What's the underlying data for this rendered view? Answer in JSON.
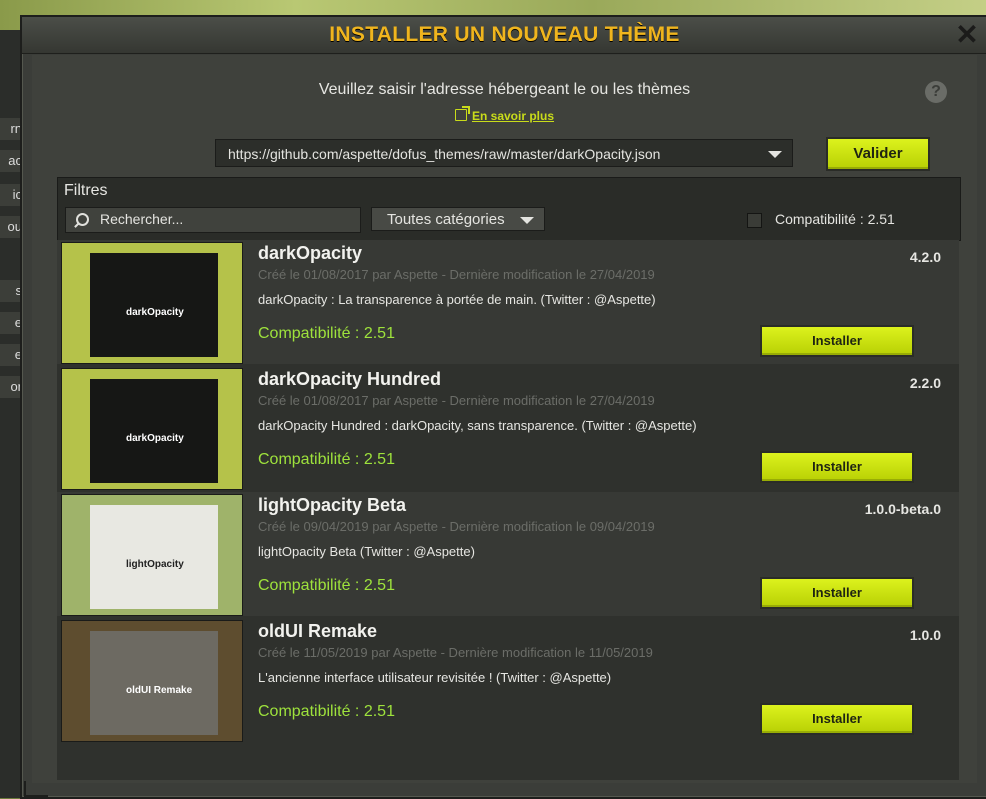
{
  "window": {
    "title": "INSTALLER UN NOUVEAU THÈME",
    "close_icon": "close-icon"
  },
  "background": {
    "left_strip_glyphs": [
      "rn",
      "ac",
      "ic",
      "ou",
      "s",
      "e",
      "e",
      "or"
    ]
  },
  "source": {
    "prompt": "Veuillez saisir l'adresse hébergeant le ou les thèmes",
    "learn_more": "En savoir plus",
    "url": "https://github.com/aspette/dofus_themes/raw/master/darkOpacity.json",
    "validate_label": "Valider"
  },
  "filters": {
    "label": "Filtres",
    "search_placeholder": "Rechercher...",
    "category": "Toutes catégories",
    "compat_label": "Compatibilité : 2.51",
    "compat_checked": false
  },
  "themes": [
    {
      "name": "darkOpacity",
      "meta": "Créé le 01/08/2017 par Aspette - Dernière modification le 27/04/2019",
      "description": "darkOpacity : La transparence à portée de main. (Twitter : @Aspette)",
      "compat": "Compatibilité : 2.51",
      "version": "4.2.0",
      "install_label": "Installer",
      "thumb_text": "darkOpacity",
      "thumb_style": "dark"
    },
    {
      "name": "darkOpacity Hundred",
      "meta": "Créé le 01/08/2017 par Aspette - Dernière modification le 27/04/2019",
      "description": "darkOpacity Hundred : darkOpacity, sans transparence. (Twitter : @Aspette)",
      "compat": "Compatibilité : 2.51",
      "version": "2.2.0",
      "install_label": "Installer",
      "thumb_text": "darkOpacity",
      "thumb_style": "dark"
    },
    {
      "name": "lightOpacity Beta",
      "meta": "Créé le 09/04/2019 par Aspette - Dernière modification le 09/04/2019",
      "description": "lightOpacity Beta (Twitter : @Aspette)",
      "compat": "Compatibilité : 2.51",
      "version": "1.0.0-beta.0",
      "install_label": "Installer",
      "thumb_text": "lightOpacity",
      "thumb_style": "light"
    },
    {
      "name": "oldUI Remake",
      "meta": "Créé le 11/05/2019 par Aspette - Dernière modification le 11/05/2019",
      "description": "L'ancienne interface utilisateur revisitée ! (Twitter : @Aspette)",
      "compat": "Compatibilité : 2.51",
      "version": "1.0.0",
      "install_label": "Installer",
      "thumb_text": "oldUI Remake",
      "thumb_style": "old"
    }
  ],
  "colors": {
    "title": "#f0b51e",
    "accent_button": "#c9e10f",
    "compat_text": "#9ee23c"
  }
}
